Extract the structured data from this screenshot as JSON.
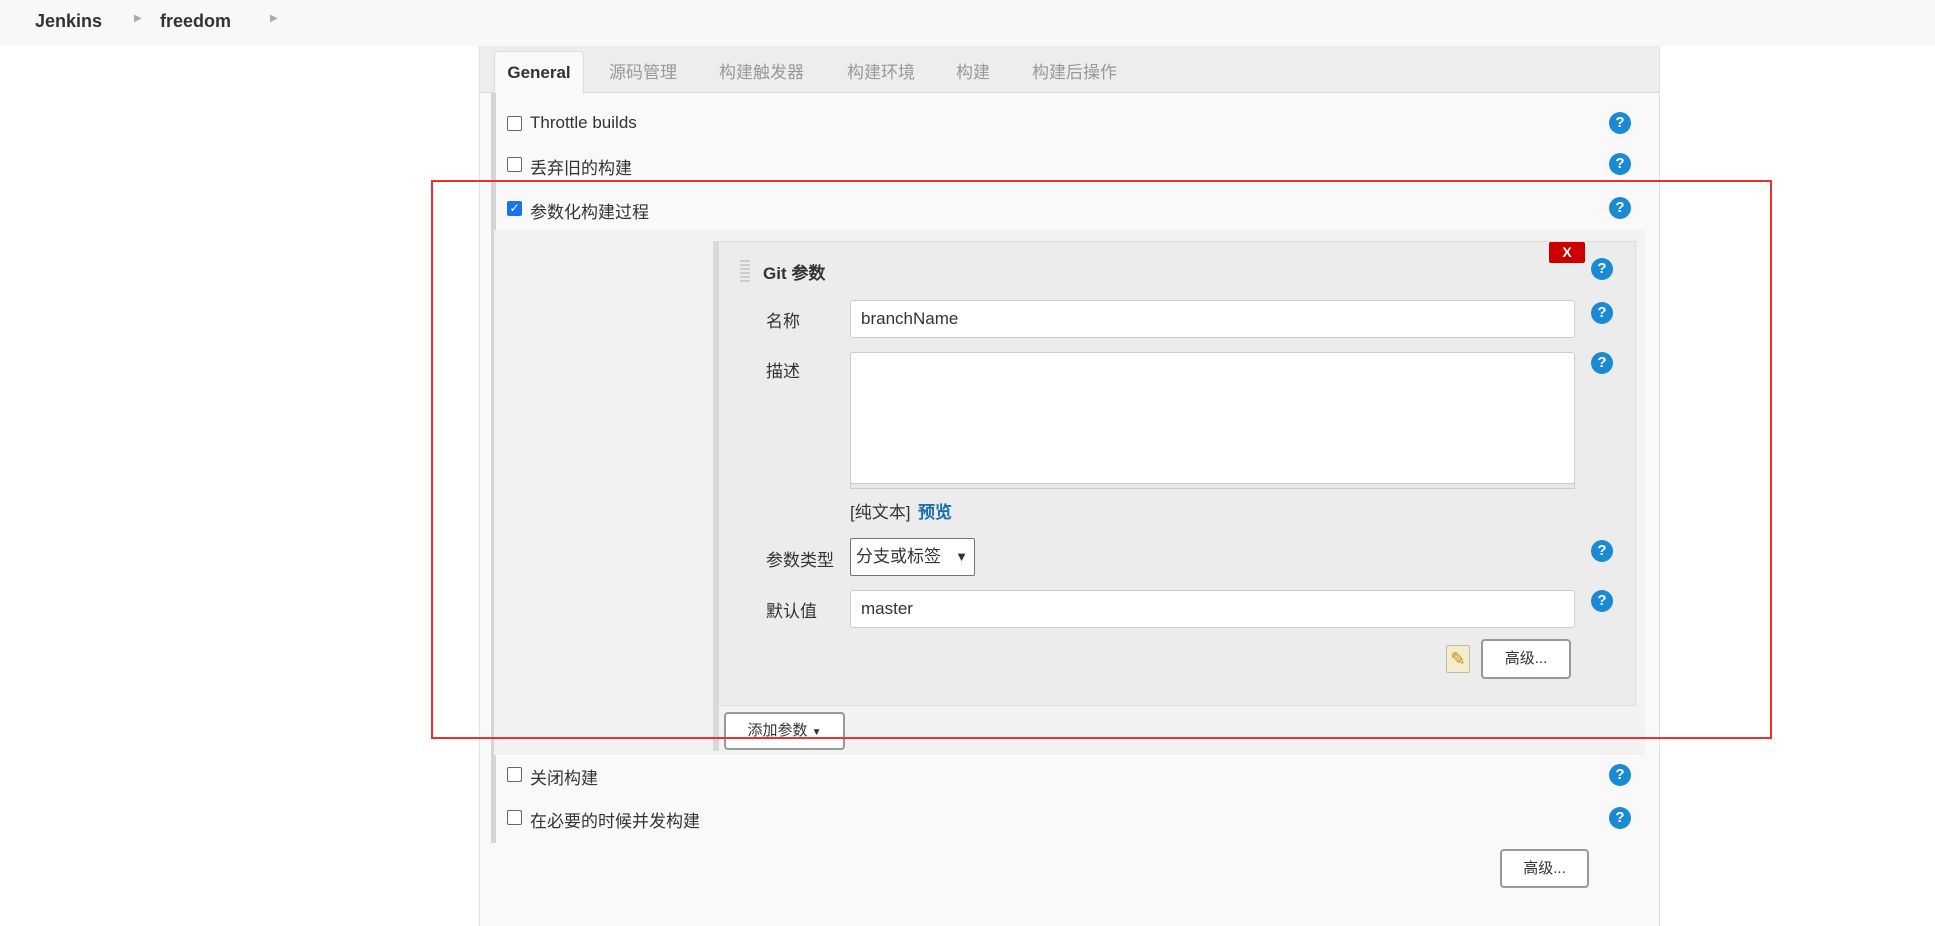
{
  "breadcrumb": {
    "items": [
      "Jenkins",
      "freedom"
    ]
  },
  "tabs": [
    "General",
    "源码管理",
    "构建触发器",
    "构建环境",
    "构建",
    "构建后操作"
  ],
  "options": [
    {
      "label": "Throttle builds",
      "checked": false
    },
    {
      "label": "丢弃旧的构建",
      "checked": false
    },
    {
      "label": "参数化构建过程",
      "checked": true
    },
    {
      "label": "关闭构建",
      "checked": false
    },
    {
      "label": "在必要的时候并发构建",
      "checked": false
    }
  ],
  "git_param": {
    "title": "Git 参数",
    "delete_label": "X",
    "name_label": "名称",
    "name_value": "branchName",
    "desc_label": "描述",
    "desc_value": "",
    "plain_text": "[纯文本]",
    "preview": "预览",
    "type_label": "参数类型",
    "type_value": "分支或标签",
    "default_label": "默认值",
    "default_value": "master",
    "advanced": "高级..."
  },
  "add_param": "添加参数",
  "advanced": "高级...",
  "help": "?",
  "colors": {
    "help": "#1a8ad4",
    "delete": "#cc0000",
    "highlight": "#e8322f",
    "link": "#1a6fb0"
  }
}
